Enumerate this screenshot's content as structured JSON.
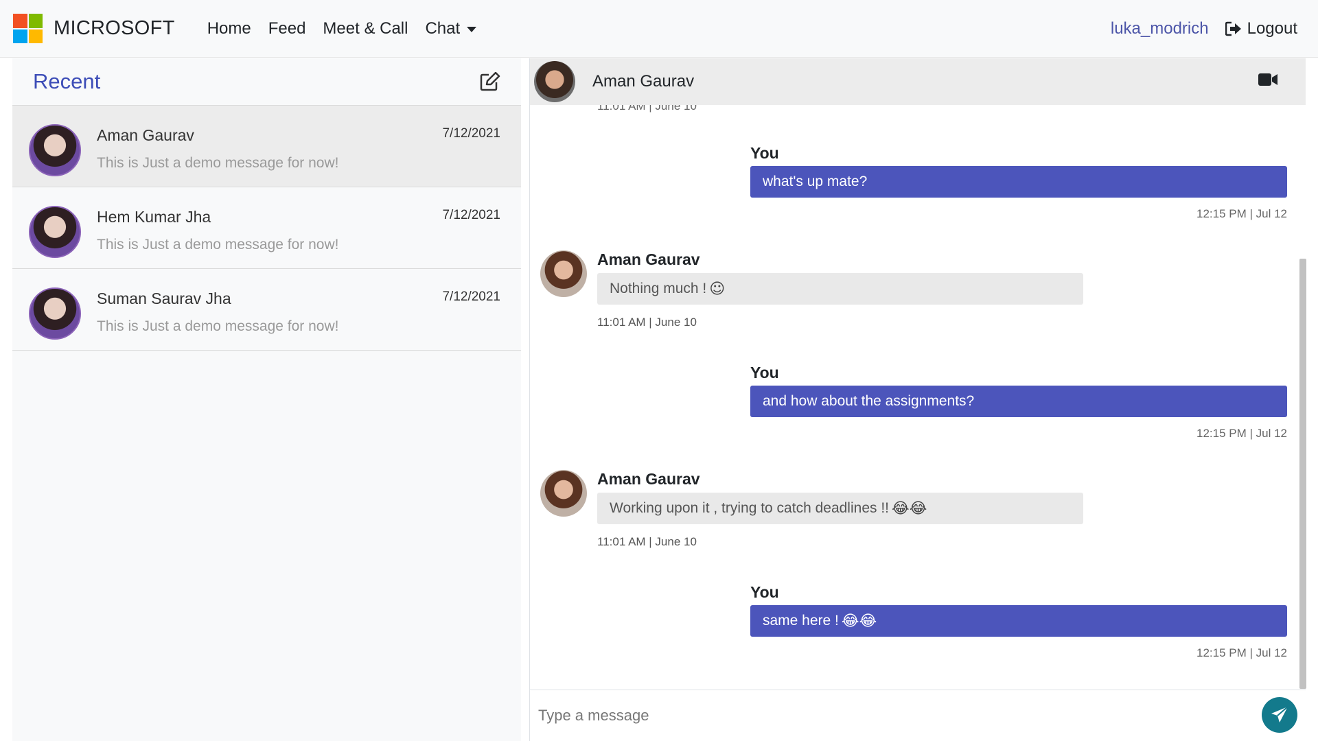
{
  "navbar": {
    "brand": "MICROSOFT",
    "logo_colors": [
      "#f25022",
      "#7fba00",
      "#00a4ef",
      "#ffb900"
    ],
    "links": [
      "Home",
      "Feed",
      "Meet & Call",
      "Chat"
    ],
    "username": "luka_modrich",
    "logout_label": "Logout"
  },
  "sidebar": {
    "title": "Recent",
    "contacts": [
      {
        "name": "Aman Gaurav",
        "date": "7/12/2021",
        "preview": "This is Just a demo message for now!"
      },
      {
        "name": "Hem Kumar Jha",
        "date": "7/12/2021",
        "preview": "This is Just a demo message for now!"
      },
      {
        "name": "Suman Saurav Jha",
        "date": "7/12/2021",
        "preview": "This is Just a demo message for now!"
      }
    ]
  },
  "chat": {
    "header_name": "Aman Gaurav",
    "cut_timestamp": "11:01 AM | June 10",
    "messages": [
      {
        "sender": "You",
        "text": "what's up mate?",
        "time": "12:15 PM | Jul 12"
      },
      {
        "sender": "Aman Gaurav",
        "text": "Nothing much ! ",
        "emoji": "☺",
        "time": "11:01 AM | June 10"
      },
      {
        "sender": "You",
        "text": "and how about the assignments?",
        "time": "12:15 PM | Jul 12"
      },
      {
        "sender": "Aman Gaurav",
        "text": "Working upon it , trying to catch deadlines !!",
        "emoji": "😂😂",
        "time": "11:01 AM | June 10"
      },
      {
        "sender": "You",
        "text": "same here !",
        "emoji": "😂😂",
        "time": "12:15 PM | Jul 12"
      }
    ],
    "input_placeholder": "Type a message"
  },
  "colors": {
    "accent": "#4c55bb",
    "recent_title": "#3d4db7",
    "send_button": "#137a8c"
  }
}
